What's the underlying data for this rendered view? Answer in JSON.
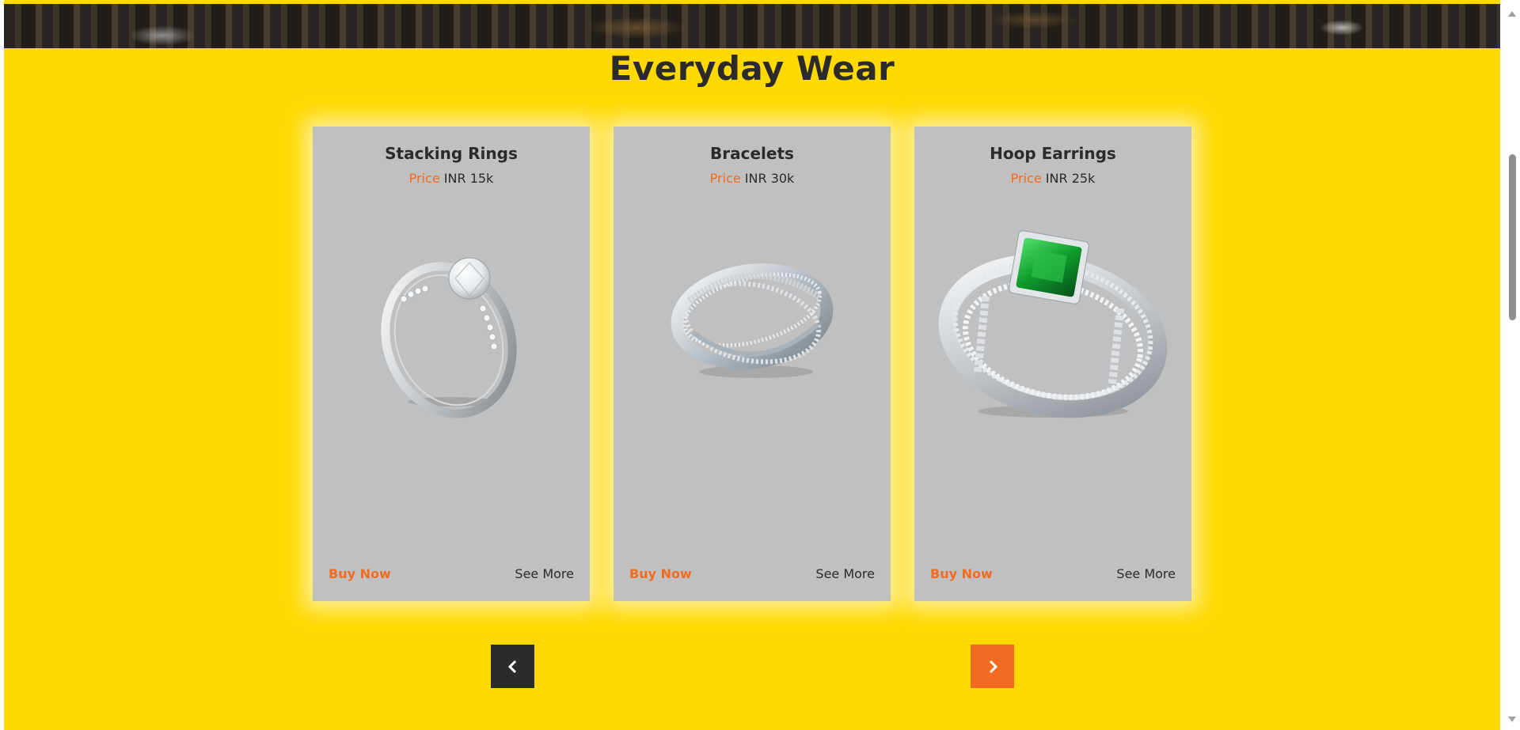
{
  "section": {
    "title": "Everyday Wear"
  },
  "cards": [
    {
      "title": "Stacking Rings",
      "price_label": "Price",
      "price_value": "INR 15k",
      "buy_label": "Buy Now",
      "more_label": "See More"
    },
    {
      "title": "Bracelets",
      "price_label": "Price",
      "price_value": "INR 30k",
      "buy_label": "Buy Now",
      "more_label": "See More"
    },
    {
      "title": "Hoop Earrings",
      "price_label": "Price",
      "price_value": "INR 25k",
      "buy_label": "Buy Now",
      "more_label": "See More"
    }
  ],
  "carousel": {
    "prev_icon": "chevron-left-icon",
    "next_icon": "chevron-right-icon"
  },
  "colors": {
    "background": "#ffd900",
    "accent": "#f26b21",
    "card": "#c0c0c0",
    "dark": "#2b2b2b"
  }
}
